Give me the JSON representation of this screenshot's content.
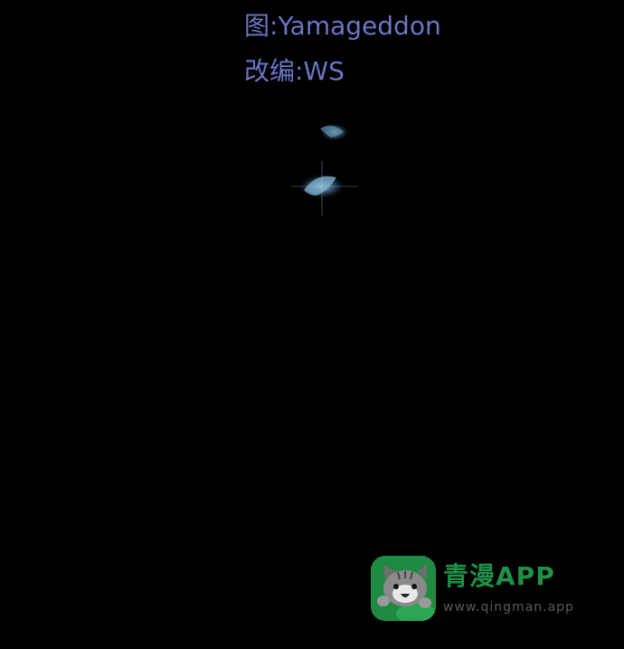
{
  "credits": {
    "art": "图:Yamageddon",
    "adaptation": "改编:WS"
  },
  "watermark": {
    "brand": "青漫APP",
    "url": "www.qingman.app",
    "logo_icon": "cat-mascot-icon"
  },
  "colors": {
    "background": "#000000",
    "credit_text": "#6b76c6",
    "brand_green": "#1f9046",
    "url_gray": "#5a5a5a"
  }
}
